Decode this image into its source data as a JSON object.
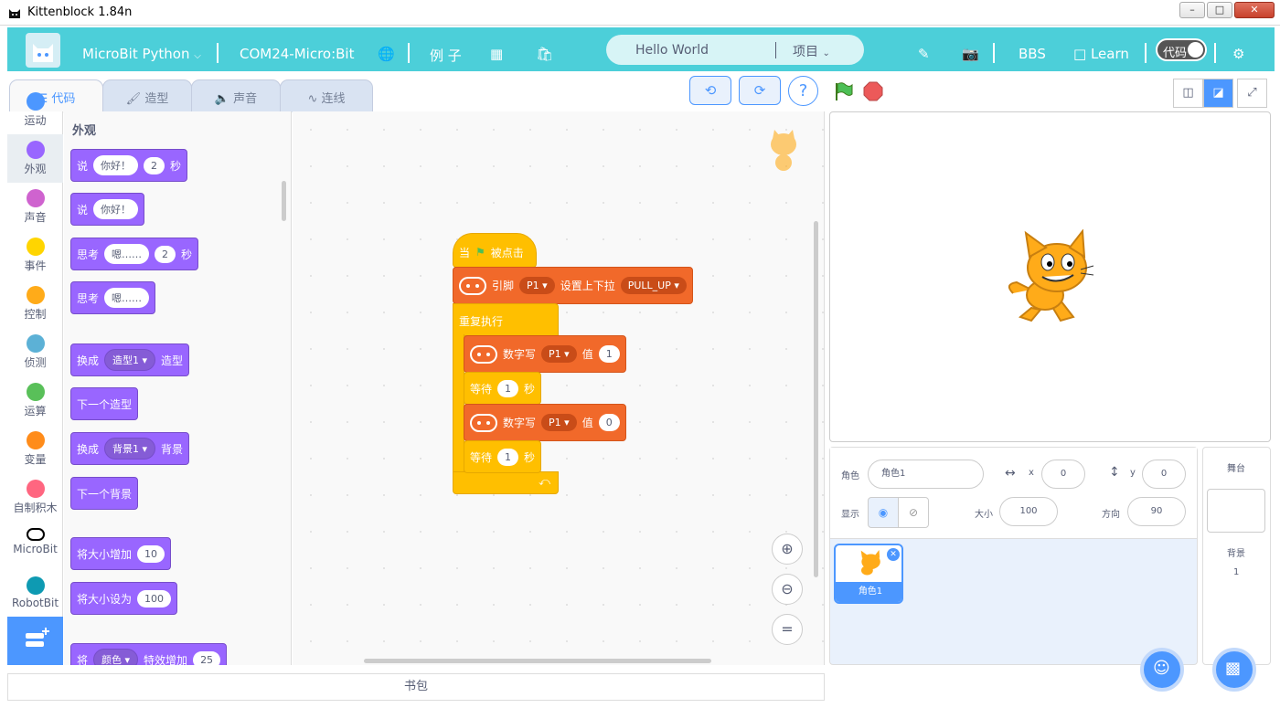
{
  "window": {
    "title": "Kittenblock 1.84n"
  },
  "menubar": {
    "mode": "MicroBit Python",
    "port": "COM24-Micro:Bit",
    "examples": "例 子",
    "project_name": "Hello World",
    "project_menu": "项目",
    "bbs": "BBS",
    "learn": "Learn",
    "code_toggle": "代码"
  },
  "tabs": {
    "code": "代码",
    "costumes": "造型",
    "sounds": "声音",
    "connect": "连线"
  },
  "categories": [
    {
      "label": "运动",
      "color": "#4c97ff"
    },
    {
      "label": "外观",
      "color": "#9966ff"
    },
    {
      "label": "声音",
      "color": "#cf63cf"
    },
    {
      "label": "事件",
      "color": "#ffd500"
    },
    {
      "label": "控制",
      "color": "#ffab19"
    },
    {
      "label": "侦测",
      "color": "#5cb1d6"
    },
    {
      "label": "运算",
      "color": "#59c059"
    },
    {
      "label": "变量",
      "color": "#ff8c1a"
    },
    {
      "label": "自制积木",
      "color": "#ff6680"
    },
    {
      "label": "MicroBit",
      "color": "#000000"
    },
    {
      "label": "RobotBit",
      "color": "#0e9ab2"
    }
  ],
  "flyout": {
    "header": "外观",
    "blocks": {
      "say_secs": {
        "a": "说",
        "v": "你好！",
        "n": "2",
        "b": "秒"
      },
      "say": {
        "a": "说",
        "v": "你好！"
      },
      "think_secs": {
        "a": "思考",
        "v": "嗯……",
        "n": "2",
        "b": "秒"
      },
      "think": {
        "a": "思考",
        "v": "嗯……"
      },
      "switch_costume": {
        "a": "换成",
        "v": "造型1",
        "b": "造型"
      },
      "next_costume": "下一个造型",
      "switch_backdrop": {
        "a": "换成",
        "v": "背景1",
        "b": "背景"
      },
      "next_backdrop": "下一个背景",
      "change_size": {
        "a": "将大小增加",
        "v": "10"
      },
      "set_size": {
        "a": "将大小设为",
        "v": "100"
      },
      "change_effect": {
        "a": "将",
        "v": "颜色",
        "b": "特效增加",
        "n": "25"
      }
    }
  },
  "script": {
    "hat": {
      "a": "当",
      "b": "被点击"
    },
    "pin_pull": {
      "a": "引脚",
      "pin": "P1",
      "b": "设置上下拉",
      "mode": "PULL_UP"
    },
    "forever": "重复执行",
    "write1": {
      "a": "数字写",
      "pin": "P1",
      "b": "值",
      "v": "1"
    },
    "wait1": {
      "a": "等待",
      "v": "1",
      "b": "秒"
    },
    "write0": {
      "a": "数字写",
      "pin": "P1",
      "b": "值",
      "v": "0"
    },
    "wait2": {
      "a": "等待",
      "v": "1",
      "b": "秒"
    }
  },
  "sprite_info": {
    "sprite_label": "角色",
    "sprite_name": "角色1",
    "x_label": "x",
    "x": "0",
    "y_label": "y",
    "y": "0",
    "show_label": "显示",
    "size_label": "大小",
    "size": "100",
    "direction_label": "方向",
    "direction": "90"
  },
  "sprite_list": [
    {
      "name": "角色1"
    }
  ],
  "stage_panel": {
    "title": "舞台",
    "backdrop_label": "背景",
    "backdrop_count": "1"
  },
  "backpack": "书包"
}
